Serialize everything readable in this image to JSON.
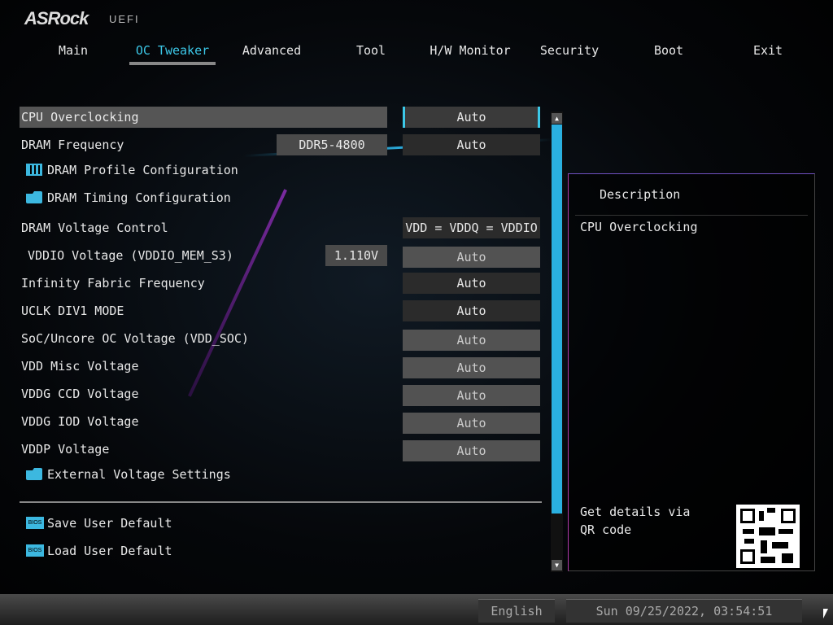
{
  "header": {
    "logo": "ASRock",
    "subtitle": "UEFI"
  },
  "tabs": [
    {
      "label": "Main"
    },
    {
      "label": "OC Tweaker"
    },
    {
      "label": "Advanced"
    },
    {
      "label": "Tool"
    },
    {
      "label": "H/W Monitor"
    },
    {
      "label": "Security"
    },
    {
      "label": "Boot"
    },
    {
      "label": "Exit"
    }
  ],
  "active_tab": "OC Tweaker",
  "settings": [
    {
      "label": "CPU Overclocking",
      "option": "Auto"
    },
    {
      "label": "DRAM Frequency",
      "value": "DDR5-4800",
      "option": "Auto"
    },
    {
      "label": "DRAM Profile Configuration",
      "icon": "memory-icon"
    },
    {
      "label": "DRAM Timing Configuration",
      "icon": "folder-icon"
    },
    {
      "label": "DRAM Voltage Control",
      "option": "VDD = VDDQ = VDDIO"
    },
    {
      "label": "VDDIO Voltage (VDDIO_MEM_S3)",
      "value": "1.110V",
      "option": "Auto"
    },
    {
      "label": "Infinity Fabric Frequency",
      "option": "Auto"
    },
    {
      "label": "UCLK DIV1 MODE",
      "option": "Auto"
    },
    {
      "label": "SoC/Uncore OC Voltage (VDD_SOC)",
      "option": "Auto"
    },
    {
      "label": "VDD Misc Voltage",
      "option": "Auto"
    },
    {
      "label": "VDDG CCD Voltage",
      "option": "Auto"
    },
    {
      "label": "VDDG IOD Voltage",
      "option": "Auto"
    },
    {
      "label": "VDDP Voltage",
      "option": "Auto"
    },
    {
      "label": "External Voltage Settings",
      "icon": "folder-icon"
    }
  ],
  "actions": [
    {
      "label": "Save User Default",
      "icon": "bios-icon",
      "icon_text": "BIOS"
    },
    {
      "label": "Load User Default",
      "icon": "bios-icon",
      "icon_text": "BIOS"
    }
  ],
  "description": {
    "title": "Description",
    "text": "CPU Overclocking",
    "qr_text": "Get details via QR code"
  },
  "footer": {
    "language": "English",
    "datetime": "Sun 09/25/2022, 03:54:51"
  },
  "scrollbar": {
    "position_fraction": 0.0,
    "visible_fraction": 0.85
  },
  "colors": {
    "accent": "#3cc8e8",
    "selected_row": "#555555"
  }
}
